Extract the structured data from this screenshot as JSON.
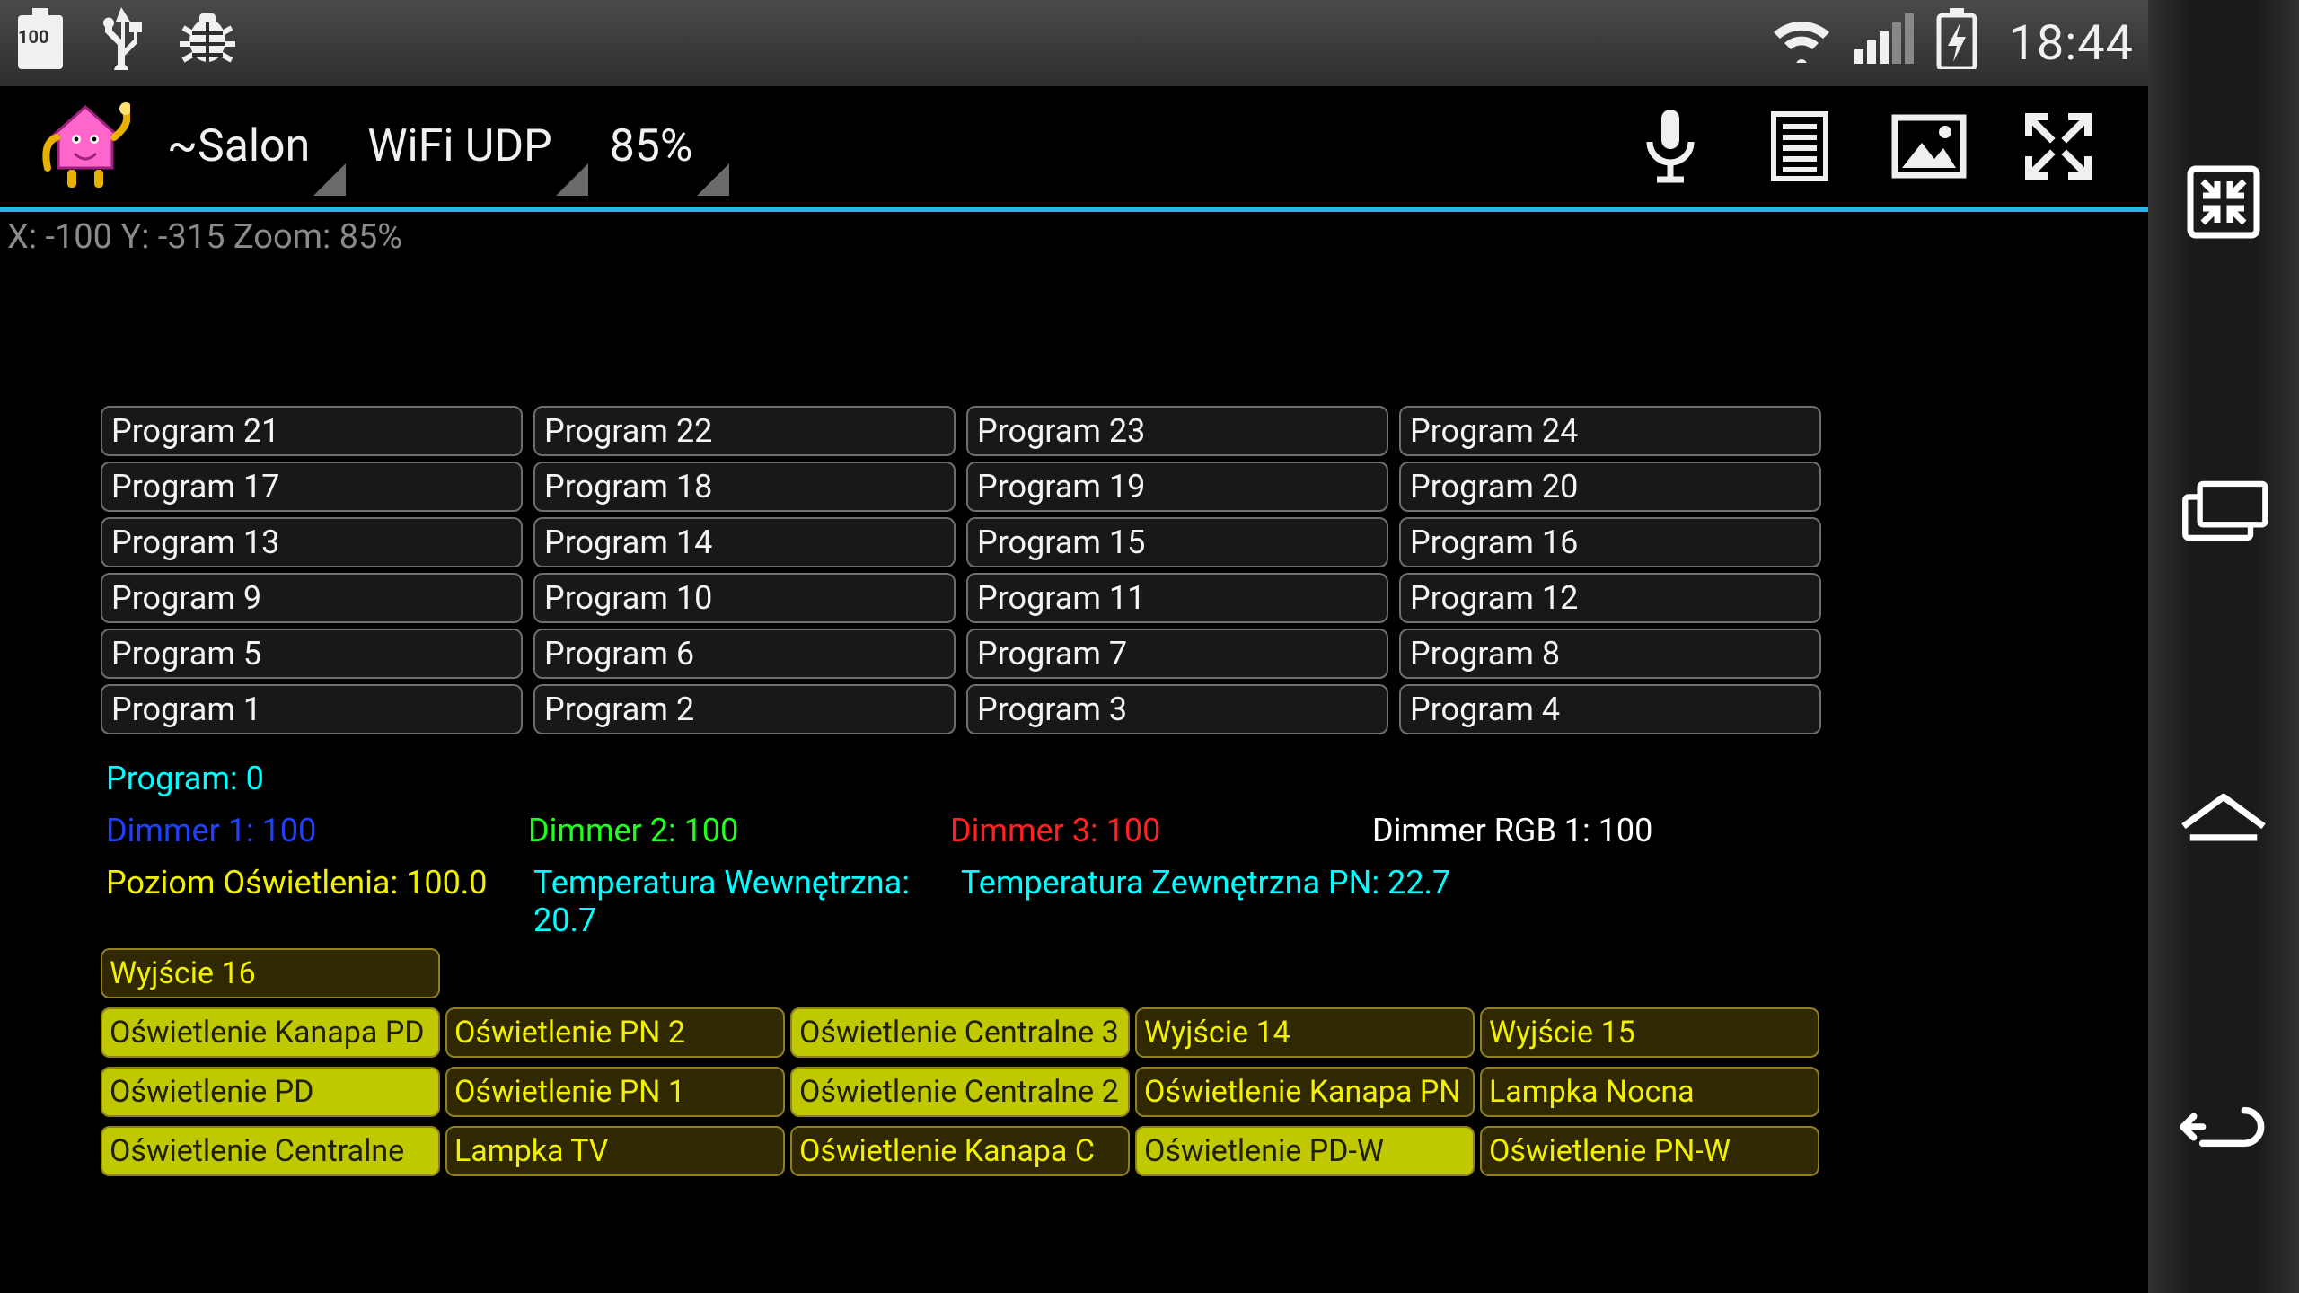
{
  "status": {
    "time": "18:44",
    "battery_level": "100"
  },
  "appbar": {
    "room": "~Salon",
    "connection": "WiFi UDP",
    "zoom": "85%"
  },
  "coords_text": "X: -100 Y: -315 Zoom: 85%",
  "programs": [
    [
      "Program 21",
      "Program 22",
      "Program 23",
      "Program 24"
    ],
    [
      "Program 17",
      "Program 18",
      "Program 19",
      "Program 20"
    ],
    [
      "Program 13",
      "Program 14",
      "Program 15",
      "Program 16"
    ],
    [
      "Program 9",
      "Program 10",
      "Program 11",
      "Program 12"
    ],
    [
      "Program 5",
      "Program 6",
      "Program 7",
      "Program 8"
    ],
    [
      "Program 1",
      "Program 2",
      "Program 3",
      "Program 4"
    ]
  ],
  "program_status": "Program: 0",
  "dimmers": {
    "d1": "Dimmer 1: 100",
    "d2": "Dimmer 2: 100",
    "d3": "Dimmer 3: 100",
    "drgb": "Dimmer RGB 1: 100"
  },
  "info": {
    "level": "Poziom Oświetlenia: 100.0",
    "temp_in": "Temperatura Wewnętrzna: 20.7",
    "temp_out": "Temperatura Zewnętrzna PN: 22.7"
  },
  "outputs": [
    [
      {
        "label": "Wyjście 16",
        "on": false
      }
    ],
    [
      {
        "label": "Oświetlenie Kanapa PD",
        "on": true
      },
      {
        "label": "Oświetlenie PN 2",
        "on": false
      },
      {
        "label": "Oświetlenie Centralne 3",
        "on": true
      },
      {
        "label": "Wyjście 14",
        "on": false
      },
      {
        "label": "Wyjście 15",
        "on": false
      }
    ],
    [
      {
        "label": "Oświetlenie PD",
        "on": true
      },
      {
        "label": "Oświetlenie PN 1",
        "on": false
      },
      {
        "label": "Oświetlenie Centralne 2",
        "on": true
      },
      {
        "label": "Oświetlenie Kanapa PN",
        "on": false
      },
      {
        "label": "Lampka Nocna",
        "on": false
      }
    ],
    [
      {
        "label": "Oświetlenie Centralne",
        "on": true
      },
      {
        "label": "Lampka TV",
        "on": false
      },
      {
        "label": "Oświetlenie Kanapa C",
        "on": false
      },
      {
        "label": "Oświetlenie PD-W",
        "on": true
      },
      {
        "label": "Oświetlenie PN-W",
        "on": false
      }
    ]
  ]
}
